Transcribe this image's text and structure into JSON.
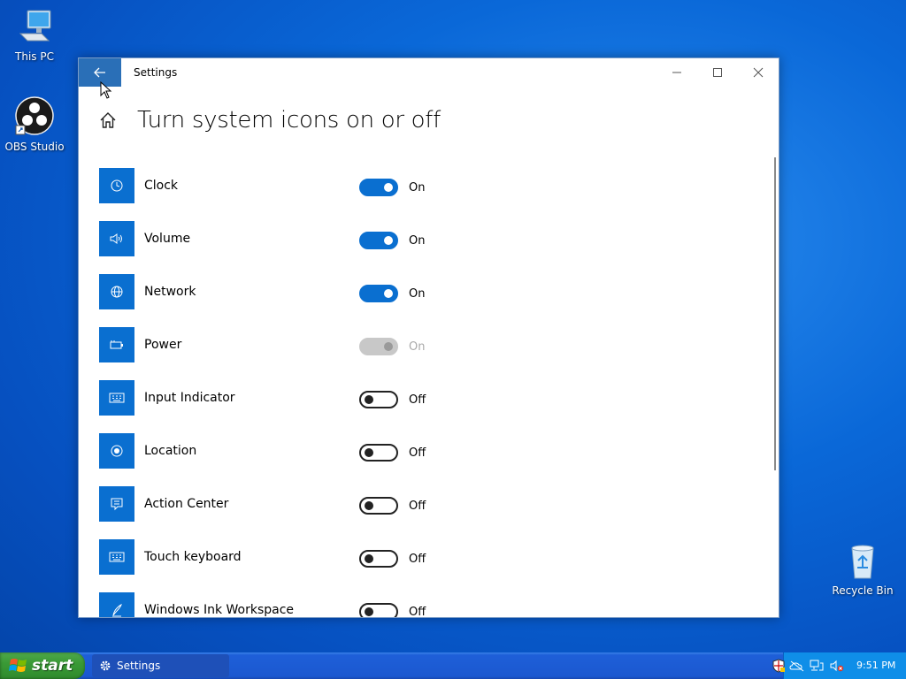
{
  "desktop": {
    "icons": [
      {
        "label": "This PC"
      },
      {
        "label": "OBS Studio"
      },
      {
        "label": "Recycle Bin"
      }
    ]
  },
  "window": {
    "title": "Settings",
    "page_title": "Turn system icons on or off"
  },
  "items": [
    {
      "label": "Clock",
      "state": "On",
      "icon": "clock-icon"
    },
    {
      "label": "Volume",
      "state": "On",
      "icon": "volume-icon"
    },
    {
      "label": "Network",
      "state": "On",
      "icon": "network-icon"
    },
    {
      "label": "Power",
      "state": "On",
      "icon": "power-icon",
      "disabled": true
    },
    {
      "label": "Input Indicator",
      "state": "Off",
      "icon": "keyboard-icon"
    },
    {
      "label": "Location",
      "state": "Off",
      "icon": "location-icon"
    },
    {
      "label": "Action Center",
      "state": "Off",
      "icon": "action-center-icon"
    },
    {
      "label": "Touch keyboard",
      "state": "Off",
      "icon": "touch-keyboard-icon"
    },
    {
      "label": "Windows Ink Workspace",
      "state": "Off",
      "icon": "pen-icon"
    }
  ],
  "taskbar": {
    "start_label": "start",
    "task_label": "Settings",
    "clock": "9:51 PM"
  },
  "colors": {
    "accent": "#0a6fd0",
    "back_button": "#2a6fb7"
  }
}
